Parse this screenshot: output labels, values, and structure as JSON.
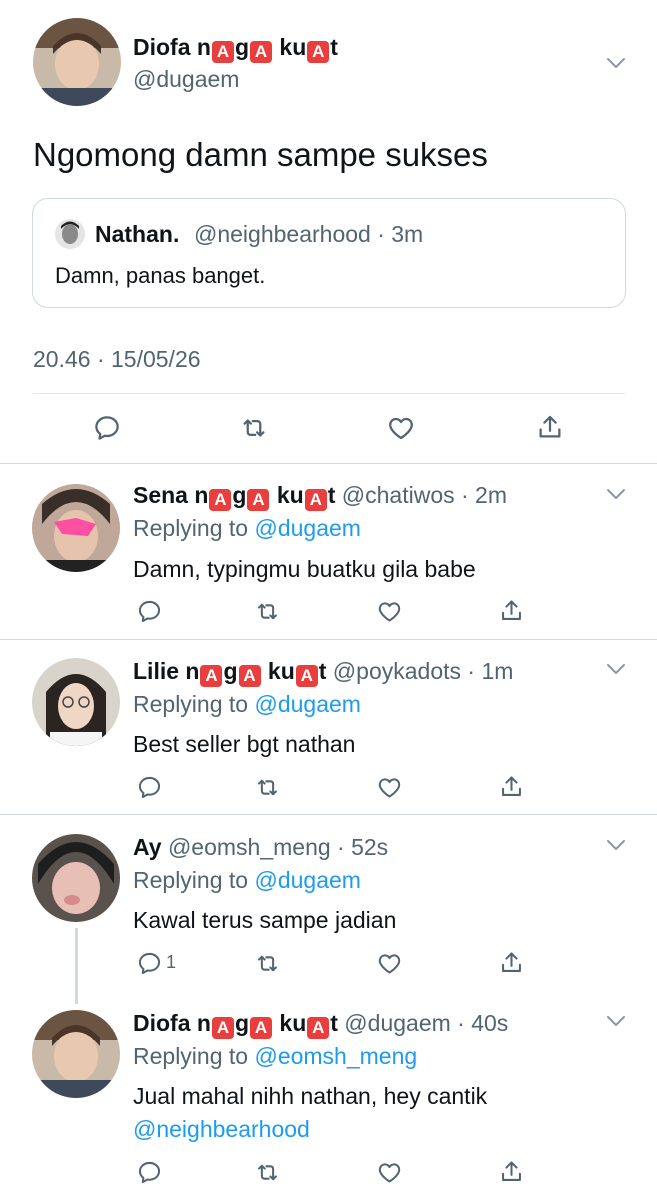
{
  "main_tweet": {
    "name_parts": [
      "Diofa n",
      "A",
      "g",
      "A",
      " ku",
      "A",
      "t"
    ],
    "handle": "@dugaem",
    "text": "Ngomong damn sampe sukses",
    "timestamp": "20.46 · 15/05/26",
    "quote": {
      "name": "Nathan.",
      "meta": "@neighbearhood · 3m",
      "text": "Damn, panas banget."
    },
    "actions": [
      "reply-icon",
      "retweet-icon",
      "like-icon",
      "share-icon"
    ]
  },
  "replies": [
    {
      "name_parts": [
        "Sena n",
        "A",
        "g",
        "A",
        " ku",
        "A",
        "t"
      ],
      "meta": " @chatiwos · 2m",
      "replying_prefix": "Replying to ",
      "replying_to": "@dugaem",
      "text": "Damn, typingmu buatku gila babe",
      "reply_count": ""
    },
    {
      "name_parts": [
        "Lilie n",
        "A",
        "g",
        "A",
        " ku",
        "A",
        "t"
      ],
      "meta": " @poykadots · 1m",
      "replying_prefix": "Replying to ",
      "replying_to": "@dugaem",
      "text": "Best seller bgt nathan",
      "reply_count": ""
    },
    {
      "name_parts": [
        "Ay"
      ],
      "meta": " @eomsh_meng · 52s",
      "replying_prefix": "Replying to ",
      "replying_to": "@dugaem",
      "text": "Kawal terus sampe jadian",
      "reply_count": "1"
    },
    {
      "name_parts": [
        "Diofa n",
        "A",
        "g",
        "A",
        " ku",
        "A",
        "t"
      ],
      "meta": " @dugaem · 40s",
      "replying_prefix": "Replying to ",
      "replying_to": "@eomsh_meng",
      "text": "Jual mahal nihh nathan, hey cantik",
      "text_line2": "@neighbearhood",
      "reply_count": ""
    }
  ],
  "colors": {
    "text": "#0f1419",
    "secondary": "#536471",
    "link": "#1d9bf0",
    "emoji_badge": "#e83e3e",
    "divider": "#cfd9de"
  }
}
